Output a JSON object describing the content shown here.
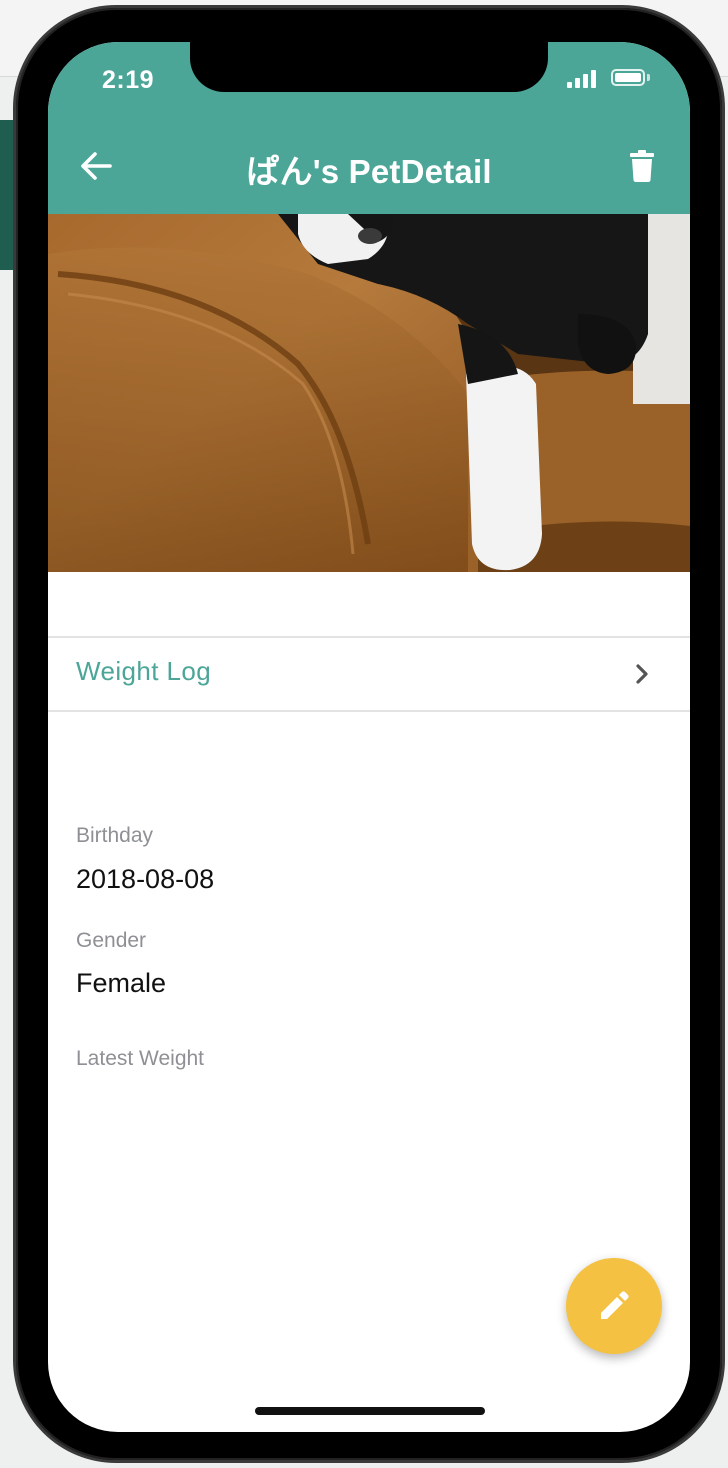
{
  "status_bar": {
    "time": "2:19"
  },
  "header": {
    "title": "ぱん's PetDetail",
    "color": "#4ca698"
  },
  "weight_log": {
    "label": "Weight Log"
  },
  "details": {
    "birthday": {
      "label": "Birthday",
      "value": "2018-08-08"
    },
    "gender": {
      "label": "Gender",
      "value": "Female"
    },
    "latest_weight": {
      "label": "Latest Weight",
      "value": ""
    }
  },
  "fab": {
    "icon": "pencil-icon",
    "color": "#f4c142"
  },
  "icons": {
    "back": "arrow-left-icon",
    "delete": "trash-icon",
    "chevron": "chevron-right-icon"
  }
}
